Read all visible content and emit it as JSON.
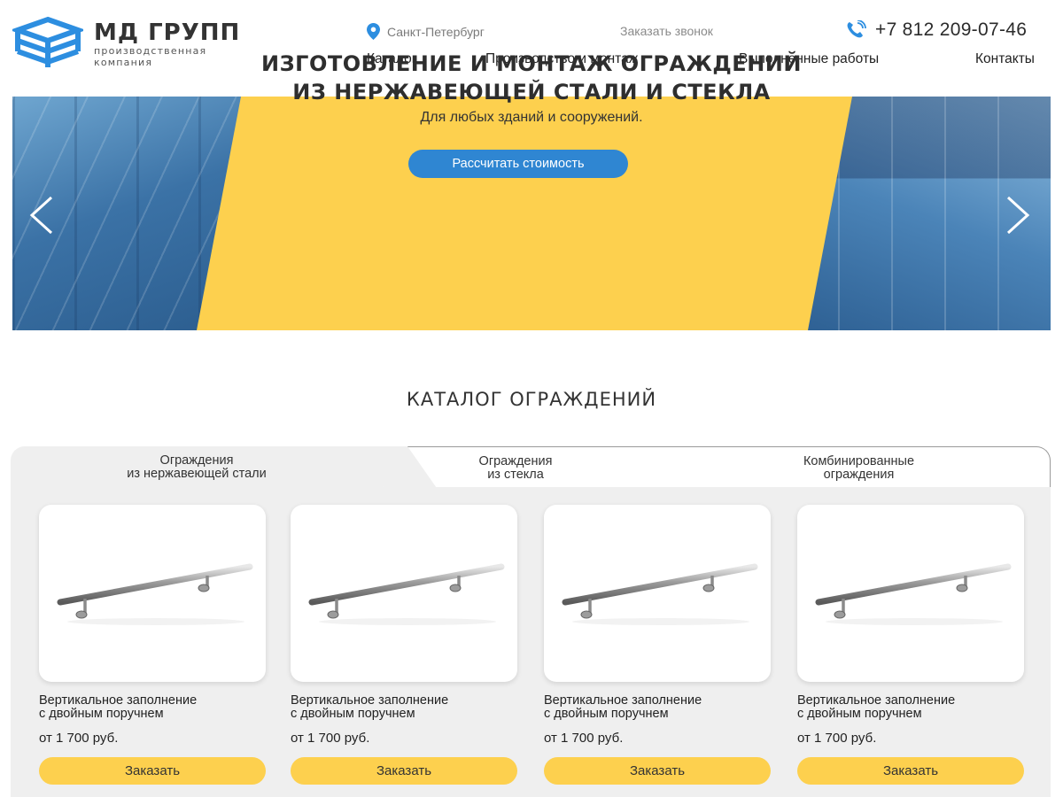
{
  "brand": {
    "name": "МД ГРУПП",
    "subtitle_line1": "производственная",
    "subtitle_line2": "компания",
    "color": "#2d8ee0"
  },
  "header": {
    "city": "Санкт-Петербург",
    "callback": "Заказать звонок",
    "phone": "+7 812 209-07-46"
  },
  "nav": {
    "items": [
      "Каталог",
      "Производство и монтаж",
      "Выполненные работы",
      "Контакты"
    ]
  },
  "hero": {
    "title_line1": "ИЗГОТОВЛЕНИЕ И МОНТАЖ ОГРАЖДЕНИЙ",
    "title_line2": "ИЗ НЕРЖАВЕЮЩЕЙ СТАЛИ И СТЕКЛА",
    "subtitle": "Для любых зданий и сооружений.",
    "button": "Рассчитать стоимость",
    "accent": "#fdd04e",
    "button_color": "#2f86d2"
  },
  "catalog": {
    "title": "КАТАЛОГ ОГРАЖДЕНИЙ",
    "tabs": [
      {
        "line1": "Ограждения",
        "line2": "из нержавеющей стали",
        "active": true
      },
      {
        "line1": "Ограждения",
        "line2": "из стекла",
        "active": false
      },
      {
        "line1": "Комбинированные",
        "line2": "ограждения",
        "active": false
      }
    ],
    "products": [
      {
        "title_line1": "Вертикальное заполнение",
        "title_line2": "с двойным поручнем",
        "price": "от 1 700 руб.",
        "button": "Заказать",
        "image": "handrail-image"
      },
      {
        "title_line1": "Вертикальное заполнение",
        "title_line2": "с двойным поручнем",
        "price": "от 1 700 руб.",
        "button": "Заказать",
        "image": "handrail-image"
      },
      {
        "title_line1": "Вертикальное заполнение",
        "title_line2": "с двойным поручнем",
        "price": "от 1 700 руб.",
        "button": "Заказать",
        "image": "handrail-image"
      },
      {
        "title_line1": "Вертикальное заполнение",
        "title_line2": "с двойным поручнем",
        "price": "от 1 700 руб.",
        "button": "Заказать",
        "image": "handrail-image"
      }
    ]
  }
}
